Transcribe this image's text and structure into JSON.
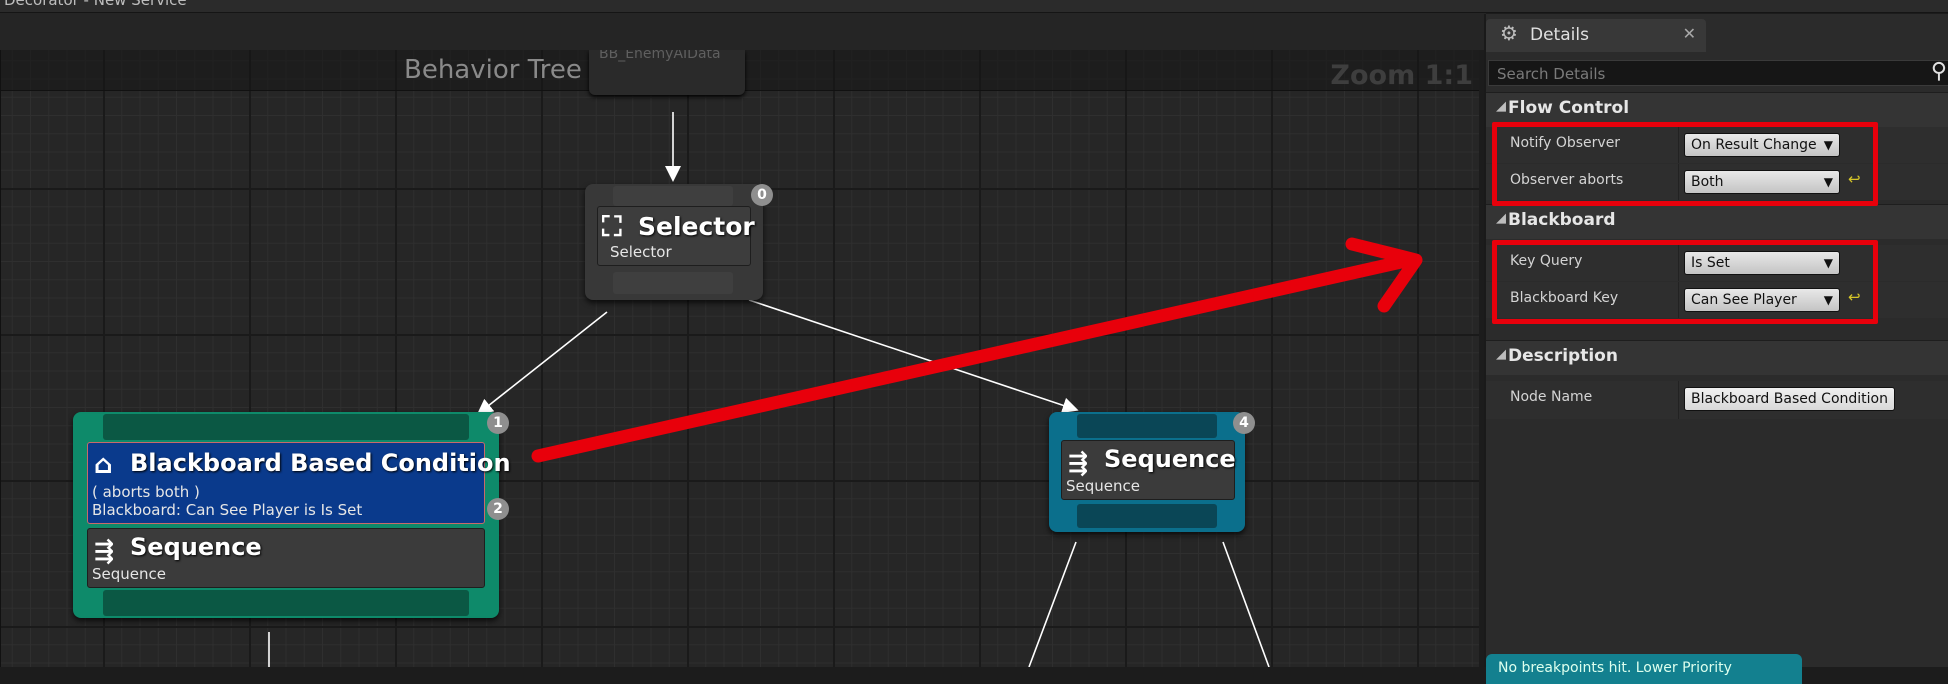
{
  "window": {
    "title": "Decorator - New Service"
  },
  "graph": {
    "title": "Behavior Tree",
    "zoom": "Zoom 1:1",
    "root_label": "BB_EnemyAIData",
    "selector": {
      "badge": "0",
      "title": "Selector",
      "subtitle": "Selector"
    },
    "left_node": {
      "badge_top": "1",
      "badge_decorator": "2",
      "decorator": {
        "title": "Blackboard Based Condition",
        "line1": "( aborts both )",
        "line2": "Blackboard: Can See Player is Is Set"
      },
      "sequence": {
        "title": "Sequence",
        "subtitle": "Sequence"
      }
    },
    "right_node": {
      "badge": "4",
      "title": "Sequence",
      "subtitle": "Sequence"
    }
  },
  "details": {
    "tab_title": "Details",
    "search_placeholder": "Search Details",
    "categories": [
      {
        "title": "Flow Control",
        "rows": [
          {
            "label": "Notify Observer",
            "value": "On Result Change"
          },
          {
            "label": "Observer aborts",
            "value": "Both"
          }
        ]
      },
      {
        "title": "Blackboard",
        "rows": [
          {
            "label": "Key Query",
            "value": "Is Set"
          },
          {
            "label": "Blackboard Key",
            "value": "Can See Player"
          }
        ]
      },
      {
        "title": "Description",
        "rows": [
          {
            "label": "Node Name",
            "value": "Blackboard Based Condition"
          }
        ]
      }
    ],
    "footer_text": "No breakpoints hit. Lower Priority"
  },
  "colors": {
    "highlight": "#e8000b",
    "decorator_blue": "#0a3a8c",
    "composite_green": "#0e8a6a",
    "sequence_teal": "#0b6f8c"
  }
}
